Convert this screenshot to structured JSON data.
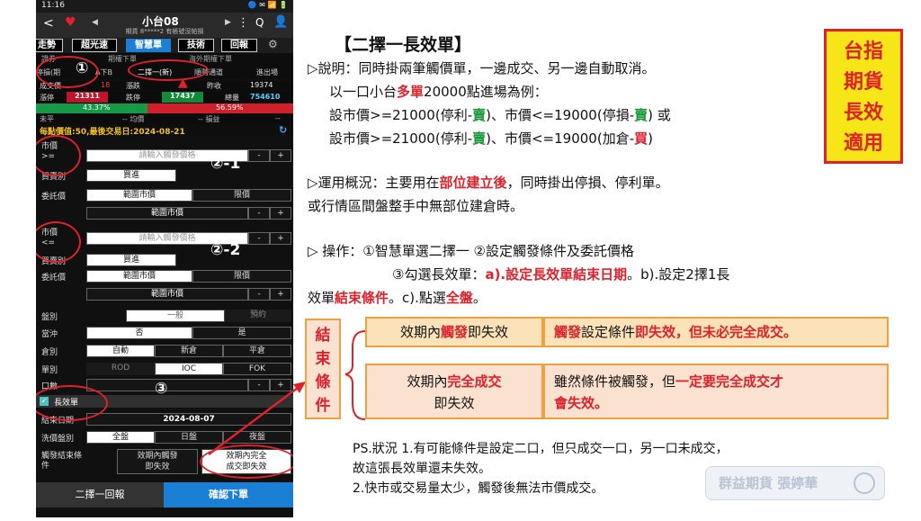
{
  "phone": {
    "status": {
      "time": "11:16",
      "right": "🔵 ✉ 📶 🔋"
    },
    "header": {
      "back": "<",
      "title": "小台08",
      "subtitle": "期貨 8*****2 有帳號沒帕損",
      "prev": "◀",
      "next": "▶",
      "menu": "⋮",
      "search": "Q"
    },
    "tabs": [
      "走勢",
      "超光速",
      "智慧單",
      "技術",
      "回報"
    ],
    "subtabs": [
      "證券",
      "期權下單",
      "海外期權下單"
    ],
    "subtabs2": [
      "停損(期",
      "A下B",
      "二擇一(新)",
      "順勢通道",
      "進出場"
    ],
    "quote": {
      "row1": [
        "成交價",
        "18",
        "漲跌",
        "4",
        "昨收",
        "19374"
      ],
      "row2": [
        "漲停",
        "21311",
        "跌停",
        "17437",
        "總量",
        "754610"
      ],
      "row3": [
        "43.37%",
        "56.59%"
      ],
      "row4": [
        "未平",
        "-- 均價",
        "-- 損益",
        "--"
      ]
    },
    "notice": "每點價值:50,最後交易日:2024-08-21",
    "refresh_icon": "↻",
    "form1": {
      "market_label": "市價\n>=",
      "placeholder": "請輸入觸發價格",
      "minus": "-",
      "plus": "+",
      "side_label": "買賣別",
      "side_value": "買進",
      "order_price_label": "委託價",
      "opt1": "範圍市價",
      "opt2": "限價",
      "price_value": "範圍市價"
    },
    "form2": {
      "market_label": "市價\n<=",
      "placeholder": "請輸入觸發價格",
      "side_label": "買賣別",
      "side_value": "買進",
      "order_price_label": "委託價",
      "opt1": "範圍市價",
      "opt2": "限價",
      "price_value": "範圍市價"
    },
    "misc": {
      "session_label": "盤別",
      "session_opt1": "一般",
      "session_opt2": "預約",
      "daytrade_label": "當沖",
      "daytrade_opt1": "否",
      "daytrade_opt2": "是",
      "position_label": "倉別",
      "position_opts": [
        "自動",
        "新倉",
        "平倉"
      ],
      "ordertype_label": "單別",
      "ordertype_opts": [
        "ROD",
        "IOC",
        "FOK"
      ],
      "qty_label": "口數",
      "long_label": "長效單",
      "end_date_label": "結束日期",
      "end_date": "2024-08-07",
      "wash_label": "洗價盤別",
      "wash_opts": [
        "全盤",
        "日盤",
        "夜盤"
      ],
      "end_cond_label": "觸發結束條件",
      "end_cond_1": "效期內觸發\n即失效",
      "end_cond_2": "效期內完全\n成交即失效"
    },
    "bottom": {
      "left": "二擇一回報",
      "right": "確認下單"
    },
    "markers": [
      "①",
      "②-1",
      "②-2",
      "③"
    ]
  },
  "doc": {
    "title": "【二擇一長效單】",
    "badge": [
      "台指",
      "期貨",
      "長效",
      "適用"
    ],
    "desc_prefix": "▷說明：",
    "desc1": "同時掛兩筆觸價單，一邊成交、另一邊自動取消。",
    "desc2_a": "以一口小台",
    "desc2_red": "多單",
    "desc2_b": "20000點進場為例：",
    "l3a": "設市價>=21000(停利-",
    "l3g": "賣",
    "l3b": ")、市價<=19000(停損-",
    "l3g2": "賣",
    "l3c": ") 或",
    "l4a": "設市價>=21000(停利-",
    "l4g": "賣",
    "l4b": ")、市價<=19000(加倉-",
    "l4r": "買",
    "l4c": ")",
    "use1_a": "▷運用概況：主要用在",
    "use1_red": "部位建立後",
    "use1_b": "，同時掛出停損、停利單。",
    "use2": "或行情區間盤整手中無部位建倉時。",
    "op1": "▷ 操作：①智慧單選二擇一  ②設定觸發條件及委託價格",
    "op2_a": "③勾選長效單：",
    "op2_red": "a).設定長效單結束日期",
    "op2_b": "。b).設定2擇1長",
    "op3_a": "效單",
    "op3_red": "結束條件",
    "op3_b": "。c).點選",
    "op3_red2": "全盤",
    "op3_c": "。",
    "end_cond_label": [
      "結",
      "束",
      "條",
      "件"
    ],
    "box1_a": "效期內",
    "box1_red": "觸發",
    "box1_b": "即失效",
    "box2_red1": "觸發",
    "box2_a": "設定條件",
    "box2_red2": "即失效，但未必完全成交。",
    "box3_a": "效期內",
    "box3_red": "完全成交",
    "box3_b": "即失效",
    "box4_a": "雖然條件被觸發，但",
    "box4_red": "一定要完全成交才",
    "box4_red2": "會失效。",
    "ps1": "PS.狀況 1.有可能條件是設定二口，但只成交一口，另一口未成交，",
    "ps2": "故這張長效單還未失效。",
    "ps3": "2.快市或交易量太少，觸發後無法市價成交。",
    "watermark": "群益期貨 張婷華"
  }
}
